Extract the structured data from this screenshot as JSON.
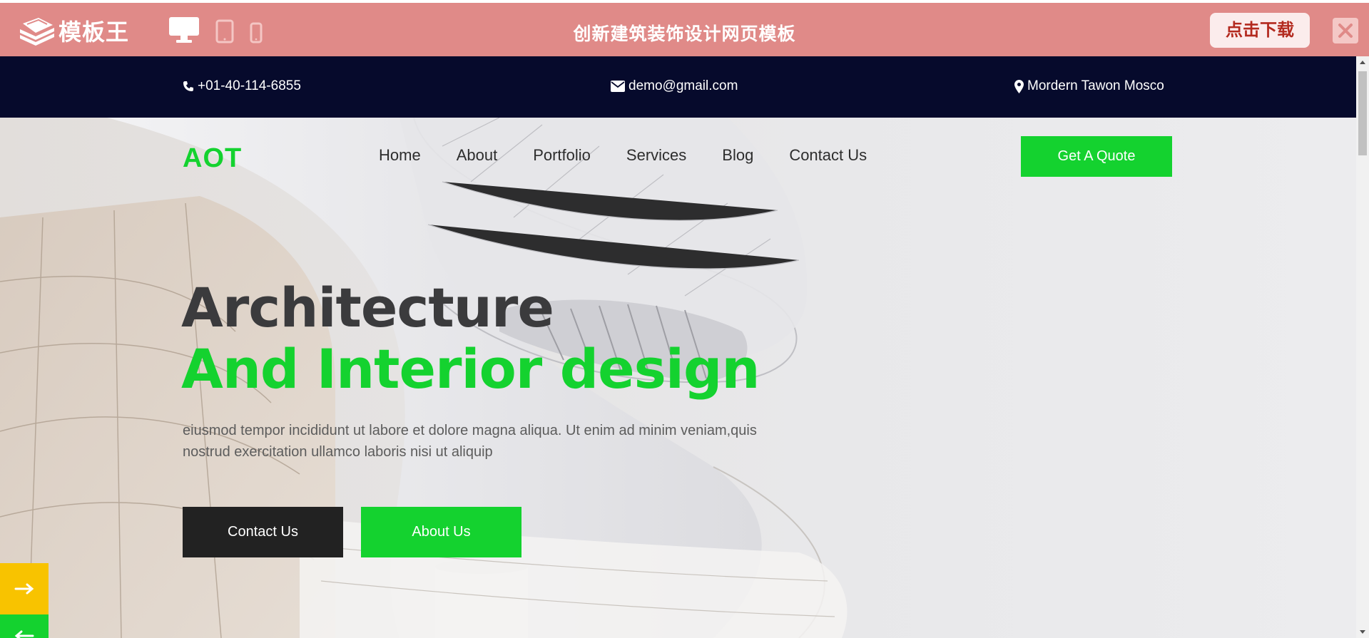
{
  "preview_bar": {
    "brand": "模板王",
    "title": "创新建筑装饰设计网页模板",
    "download_label": "点击下载",
    "devices": [
      "desktop-icon",
      "tablet-icon",
      "mobile-icon"
    ]
  },
  "contact_bar": {
    "phone": "+01-40-114-6855",
    "email": "demo@gmail.com",
    "address": "Mordern Tawon Mosco"
  },
  "nav": {
    "logo": "AOT",
    "items": [
      "Home",
      "About",
      "Portfolio",
      "Services",
      "Blog",
      "Contact Us"
    ],
    "cta": "Get A Quote"
  },
  "hero": {
    "title_line1": "Architecture",
    "title_line2": "And Interior design",
    "text": "eiusmod tempor incididunt ut labore et dolore magna aliqua. Ut enim ad minim veniam,quis nostrud exercitation ullamco laboris nisi ut aliquip",
    "button_primary": "Contact Us",
    "button_secondary": "About Us"
  },
  "colors": {
    "accent_green": "#14d22f",
    "preview_bar": "#e08a88",
    "contact_bar": "#060a2c",
    "side_yellow": "#f8c300"
  }
}
